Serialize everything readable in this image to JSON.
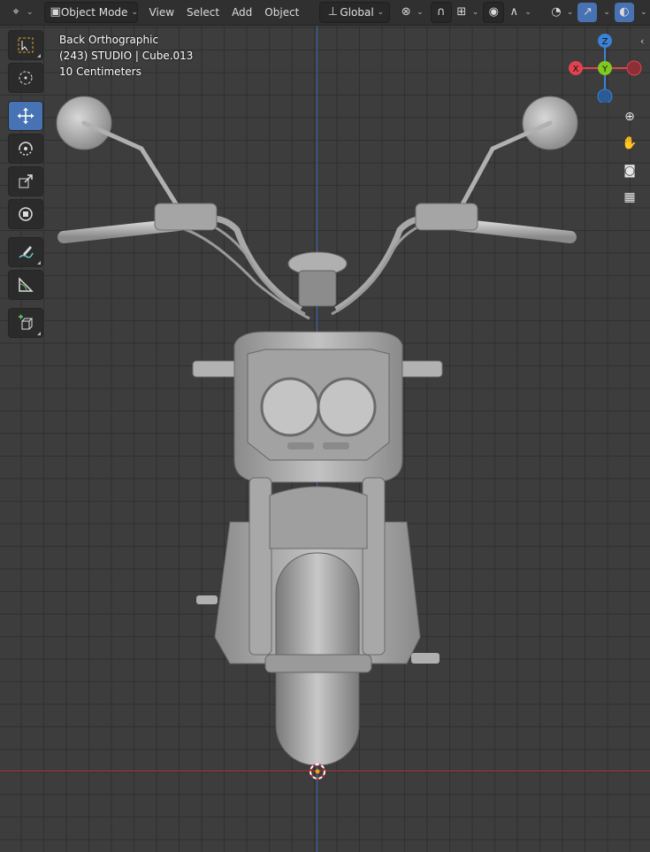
{
  "header": {
    "editor_type_icon": "viewport-icon",
    "mode_label": "Object Mode",
    "menus": [
      "View",
      "Select",
      "Add",
      "Object"
    ],
    "transform_orientation": "Global",
    "icons": {
      "pivot": "pivot-icon",
      "snap": "magnet-icon",
      "snap_target": "snap-grid-icon",
      "proportional": "proportional-edit-icon",
      "falloff": "falloff-curve-icon",
      "visibility": "eye-icon",
      "gizmo": "gizmo-icon",
      "overlay": "overlay-icon",
      "xray": "xray-icon"
    }
  },
  "overlay": {
    "view_name": "Back Orthographic",
    "object_info": "(243) STUDIO | Cube.013",
    "grid_scale": "10 Centimeters"
  },
  "toolbar": {
    "tools": [
      {
        "name": "select-box-tool",
        "icon": "select-box-icon"
      },
      {
        "name": "cursor-tool",
        "icon": "cursor-icon"
      },
      {
        "name": "move-tool",
        "icon": "move-icon",
        "active": true
      },
      {
        "name": "rotate-tool",
        "icon": "rotate-icon"
      },
      {
        "name": "scale-tool",
        "icon": "scale-icon"
      },
      {
        "name": "transform-tool",
        "icon": "transform-icon"
      },
      {
        "name": "annotate-tool",
        "icon": "annotate-icon"
      },
      {
        "name": "measure-tool",
        "icon": "measure-icon"
      },
      {
        "name": "add-cube-tool",
        "icon": "add-cube-icon"
      }
    ]
  },
  "gizmo": {
    "axes": [
      "Z",
      "X",
      "Y"
    ],
    "colors": {
      "x": "#e0434f",
      "y": "#82c91f",
      "z": "#3a82d6"
    }
  },
  "nav_buttons": [
    "zoom-icon",
    "hand-pan-icon",
    "camera-icon",
    "grid-view-icon"
  ],
  "colors": {
    "accent": "#4772b3",
    "background": "#3d3d3d",
    "grid": "#303030",
    "axis_x": "#a83a3a",
    "axis_z": "#3a66b8",
    "model": "#b4b4b4"
  }
}
